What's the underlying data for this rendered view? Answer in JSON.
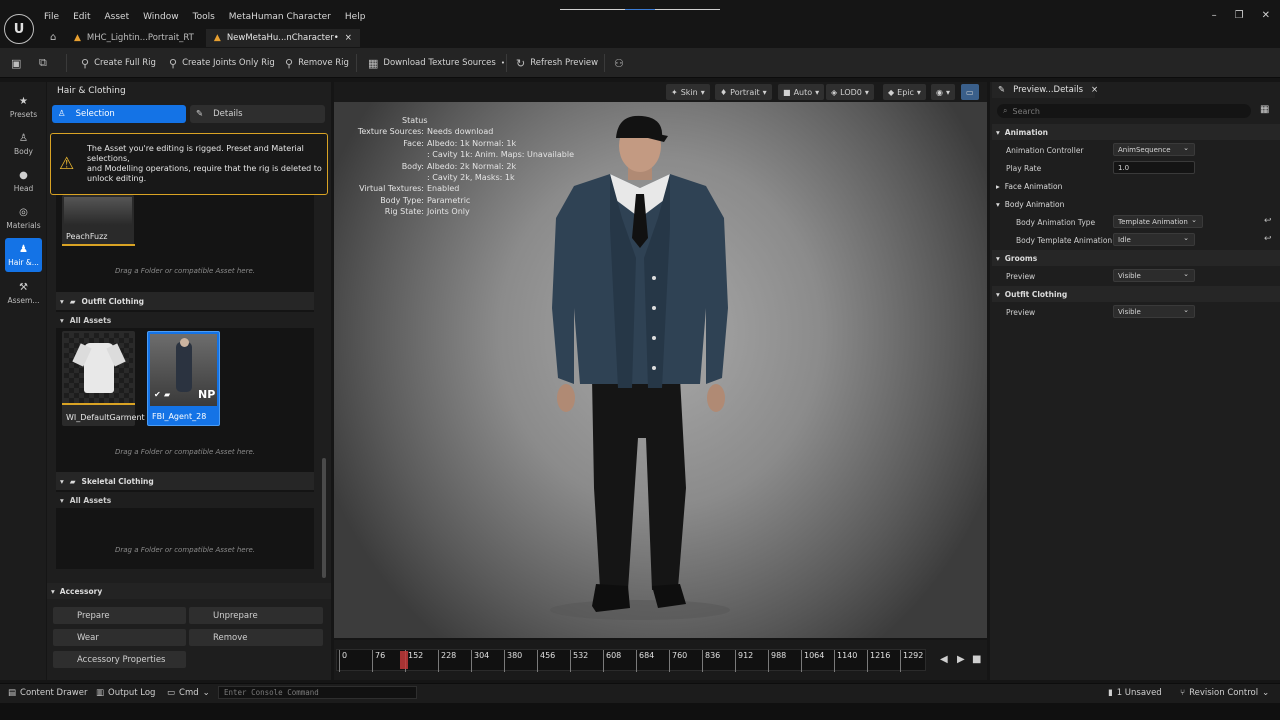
{
  "menu": [
    "File",
    "Edit",
    "Asset",
    "Window",
    "Tools",
    "MetaHuman Character",
    "Help"
  ],
  "tabs": [
    {
      "label": "MHC_Lightin...Portrait_RT",
      "icon": "triangle-warning-icon"
    },
    {
      "label": "NewMetaHu...nCharacter•",
      "close": "×"
    }
  ],
  "window_controls": {
    "minimize": "–",
    "restore": "❐",
    "close": "✕"
  },
  "toolbar": {
    "create_full_rig": "Create Full Rig",
    "create_joints_only_rig": "Create Joints Only Rig",
    "remove_rig": "Remove Rig",
    "download_texture_sources": "Download Texture Sources",
    "refresh_preview": "Refresh Preview"
  },
  "vtabs": [
    {
      "label": "Presets",
      "icon": "star-icon"
    },
    {
      "label": "Body",
      "icon": "body-icon"
    },
    {
      "label": "Head",
      "icon": "head-icon"
    },
    {
      "label": "Materials",
      "icon": "materials-icon"
    },
    {
      "label": "Hair &...",
      "icon": "hair-icon"
    },
    {
      "label": "Assem...",
      "icon": "hammer-icon"
    }
  ],
  "left_panel": {
    "title": "Hair & Clothing",
    "selection_label": "Selection",
    "details_label": "Details",
    "warning": "The Asset you're editing is rigged. Preset and Material selections,\nand Modelling operations, require that the rig is deleted to unlock editing.",
    "peachfuzz_label": "PeachFuzz",
    "drop_hint": "Drag a Folder or compatible Asset here.",
    "outfit_clothing": "Outfit Clothing",
    "all_assets": "All Assets",
    "garment_1": "WI_DefaultGarment",
    "garment_2": "FBI_Agent_28",
    "garment_2_badge": "NP",
    "skeletal_clothing": "Skeletal Clothing",
    "accessory": "Accessory",
    "prepare": "Prepare",
    "unprepare": "Unprepare",
    "wear": "Wear",
    "remove": "Remove",
    "accessory_properties": "Accessory Properties"
  },
  "viewport": {
    "buttons": {
      "skin": "Skin",
      "portrait": "Portrait",
      "auto": "Auto",
      "lod": "LOD0",
      "epic": "Epic"
    },
    "status_title": "Status",
    "status": [
      {
        "k": "Texture Sources:",
        "v": "Needs download"
      },
      {
        "k": "Face:",
        "v": "Albedo: 1k Normal: 1k"
      },
      {
        "k": "",
        "v": ": Cavity 1k: Anim. Maps: Unavailable"
      },
      {
        "k": "Body:",
        "v": "Albedo: 2k Normal: 2k"
      },
      {
        "k": "",
        "v": ": Cavity 2k, Masks: 1k"
      },
      {
        "k": "Virtual Textures:",
        "v": "Enabled"
      },
      {
        "k": "Body Type:",
        "v": "Parametric"
      },
      {
        "k": "Rig State:",
        "v": "Joints Only"
      }
    ]
  },
  "timeline": {
    "ticks": [
      "0",
      "76",
      "152",
      "228",
      "304",
      "380",
      "456",
      "532",
      "608",
      "684",
      "760",
      "836",
      "912",
      "988",
      "1064",
      "1140",
      "1216",
      "1292"
    ]
  },
  "details": {
    "tab_label": "Preview...Details",
    "search_placeholder": "Search",
    "animation": "Animation",
    "animation_controller": "Animation Controller",
    "animation_controller_value": "AnimSequence",
    "play_rate": "Play Rate",
    "play_rate_value": "1.0",
    "face_animation": "Face Animation",
    "body_animation": "Body Animation",
    "body_animation_type": "Body Animation Type",
    "body_animation_type_value": "Template Animation",
    "body_template_animation": "Body Template Animation",
    "body_template_animation_value": "Idle",
    "grooms": "Grooms",
    "grooms_preview": "Preview",
    "grooms_preview_value": "Visible",
    "outfit_clothing": "Outfit Clothing",
    "outfit_preview": "Preview",
    "outfit_preview_value": "Visible"
  },
  "statusbar": {
    "content_drawer": "Content Drawer",
    "output_log": "Output Log",
    "cmd": "Cmd",
    "console_placeholder": "Enter Console Command",
    "unsaved": "1 Unsaved",
    "revision_control": "Revision Control"
  }
}
